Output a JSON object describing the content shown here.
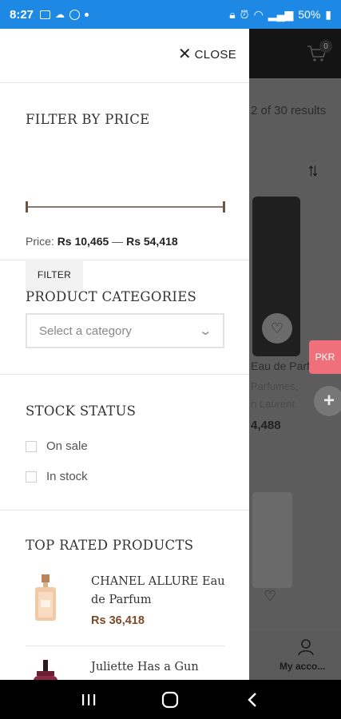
{
  "status_bar": {
    "time": "8:27",
    "battery": "50%"
  },
  "background": {
    "cart_count": "0",
    "results_text": "2 of 30 results",
    "product_title": "Eau de Parf",
    "product_category_1": "Parfumes,",
    "product_category_2": "n Laurent",
    "product_price": "4,488",
    "pkr_label": "PKR",
    "plus_label": "+",
    "my_account_label": "My acco..."
  },
  "drawer": {
    "close_label": "CLOSE",
    "price_filter": {
      "title": "FILTER BY PRICE",
      "price_prefix": "Price: ",
      "min_price": "Rs 10,465",
      "separator": " — ",
      "max_price": "Rs 54,418",
      "filter_button": "FILTER"
    },
    "categories": {
      "title": "PRODUCT CATEGORIES",
      "placeholder": "Select a category"
    },
    "stock": {
      "title": "STOCK STATUS",
      "options": [
        "On sale",
        "In stock"
      ]
    },
    "top_rated": {
      "title": "TOP RATED PRODUCTS",
      "products": [
        {
          "name": "CHANEL ALLURE Eau de Parfum",
          "price": "Rs 36,418"
        },
        {
          "name": "Juliette Has a Gun",
          "price": ""
        }
      ]
    }
  },
  "colors": {
    "status_bar": "#1e88e5",
    "accent_price": "#7a4a2a",
    "slider": "#8b7a6d",
    "pkr_tab": "#ef6f7a"
  }
}
